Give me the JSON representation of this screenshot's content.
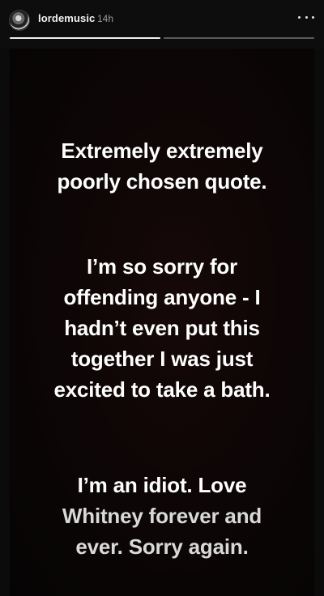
{
  "header": {
    "username": "lordemusic",
    "timestamp": "14h",
    "more_icon": "more-horizontal-icon",
    "progress": [
      1.0,
      0.0
    ]
  },
  "story": {
    "paragraphs": [
      {
        "lines": [
          "Extremely extremely",
          "poorly chosen quote."
        ]
      },
      {
        "lines": [
          "I’m so sorry for",
          "offending anyone - I",
          "hadn’t even put this",
          "together I was just",
          "excited to take a bath."
        ]
      },
      {
        "lines": [
          "I’m an idiot. Love",
          "Whitney forever and",
          "ever. Sorry again."
        ]
      }
    ]
  },
  "colors": {
    "background": "#0b0b0b",
    "text": "#ffffff",
    "timestamp": "#9a9a9a",
    "progress_track": "#5a5a5a",
    "progress_fill": "#f0f0f0"
  }
}
